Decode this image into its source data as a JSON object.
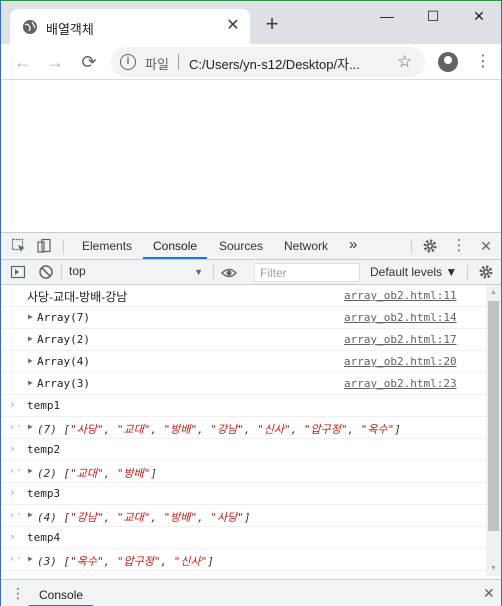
{
  "browser": {
    "tab_title": "배열객체",
    "tab_close": "✕",
    "new_tab": "+",
    "minimize": "—",
    "maximize": "☐",
    "close": "✕"
  },
  "toolbar": {
    "back": "←",
    "forward": "→",
    "reload": "⟳",
    "info": "i",
    "scheme_label": "파일",
    "url": "C:/Users/yn-s12/Desktop/자...",
    "bookmark": "☆",
    "menu": "⋮"
  },
  "devtools": {
    "tabs": [
      {
        "label": "Elements"
      },
      {
        "label": "Console"
      },
      {
        "label": "Sources"
      },
      {
        "label": "Network"
      }
    ],
    "more_tabs": "»",
    "close": "✕",
    "context": "top",
    "filter_placeholder": "Filter",
    "levels": "Default levels ▼",
    "drawer_label": "Console"
  },
  "console": {
    "logs": [
      {
        "text": "사당-교대-방배-강남",
        "source": "array_ob2.html:11"
      },
      {
        "text": "Array(7)",
        "source": "array_ob2.html:14"
      },
      {
        "text": "Array(2)",
        "source": "array_ob2.html:17"
      },
      {
        "text": "Array(4)",
        "source": "array_ob2.html:20"
      },
      {
        "text": "Array(3)",
        "source": "array_ob2.html:23"
      }
    ],
    "commands": [
      {
        "input": "temp1",
        "count": "(7)",
        "items": [
          "\"사당\"",
          "\"교대\"",
          "\"방배\"",
          "\"강남\"",
          "\"신사\"",
          "\"압구정\"",
          "\"옥수\""
        ]
      },
      {
        "input": "temp2",
        "count": "(2)",
        "items": [
          "\"교대\"",
          "\"방배\""
        ]
      },
      {
        "input": "temp3",
        "count": "(4)",
        "items": [
          "\"강남\"",
          "\"교대\"",
          "\"방배\"",
          "\"사당\""
        ]
      },
      {
        "input": "temp4",
        "count": "(3)",
        "items": [
          "\"옥수\"",
          "\"압구정\"",
          "\"신사\""
        ]
      }
    ]
  }
}
